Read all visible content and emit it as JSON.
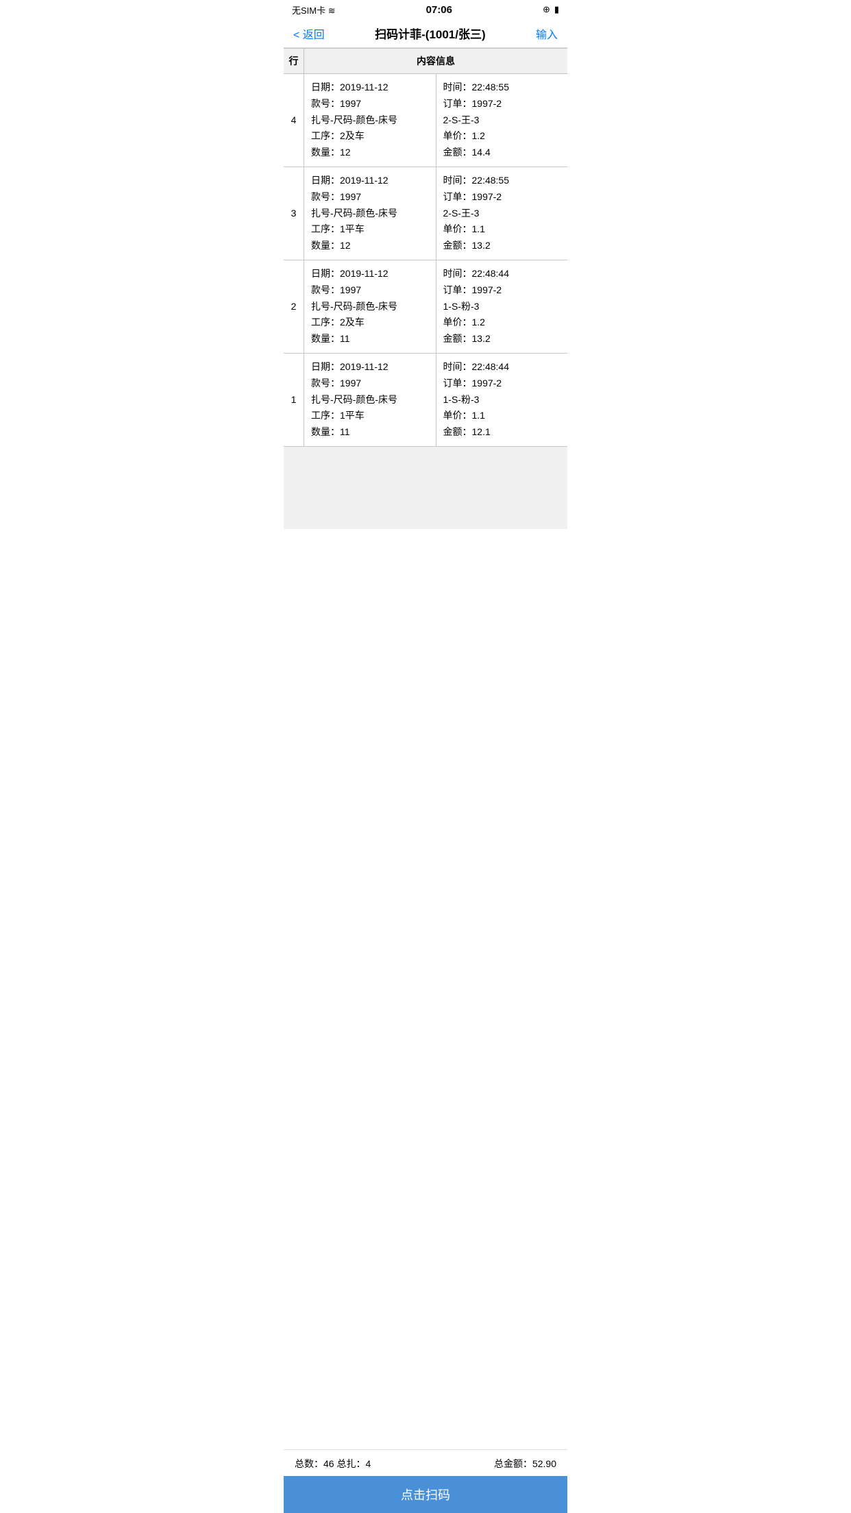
{
  "statusBar": {
    "left": "无SIM卡 ≋",
    "time": "07:06",
    "rightIcons": [
      "⊕",
      "🔋"
    ]
  },
  "nav": {
    "backLabel": "< 返回",
    "title": "扫码计菲-(1001/张三)",
    "actionLabel": "输入"
  },
  "tableHeader": {
    "rowCol": "行",
    "contentCol": "内容信息"
  },
  "rows": [
    {
      "rowNum": "4",
      "left": {
        "line1": "日期：2019-11-12",
        "line2": "款号：1997",
        "line3": "扎号-尺码-颜色-床号",
        "line4": "工序：2及车",
        "line5": "数量：12"
      },
      "right": {
        "line1": "时间：22:48:55",
        "line2": "订单：1997-2",
        "line3": "2-S-王-3",
        "line4": "单价：1.2",
        "line5": "金额：14.4"
      }
    },
    {
      "rowNum": "3",
      "left": {
        "line1": "日期：2019-11-12",
        "line2": "款号：1997",
        "line3": "扎号-尺码-颜色-床号",
        "line4": "工序：1平车",
        "line5": "数量：12"
      },
      "right": {
        "line1": "时间：22:48:55",
        "line2": "订单：1997-2",
        "line3": "2-S-王-3",
        "line4": "单价：1.1",
        "line5": "金额：13.2"
      }
    },
    {
      "rowNum": "2",
      "left": {
        "line1": "日期：2019-11-12",
        "line2": "款号：1997",
        "line3": "扎号-尺码-颜色-床号",
        "line4": "工序：2及车",
        "line5": "数量：11"
      },
      "right": {
        "line1": "时间：22:48:44",
        "line2": "订单：1997-2",
        "line3": "1-S-粉-3",
        "line4": "单价：1.2",
        "line5": "金额：13.2"
      }
    },
    {
      "rowNum": "1",
      "left": {
        "line1": "日期：2019-11-12",
        "line2": "款号：1997",
        "line3": "扎号-尺码-颜色-床号",
        "line4": "工序：1平车",
        "line5": "数量：11"
      },
      "right": {
        "line1": "时间：22:48:44",
        "line2": "订单：1997-2",
        "line3": "1-S-粉-3",
        "line4": "单价：1.1",
        "line5": "金额：12.1"
      }
    }
  ],
  "footer": {
    "summaryLeft": "总数：46 总扎：4",
    "summaryRight": "总金额：52.90",
    "scanButtonLabel": "点击扫码"
  }
}
